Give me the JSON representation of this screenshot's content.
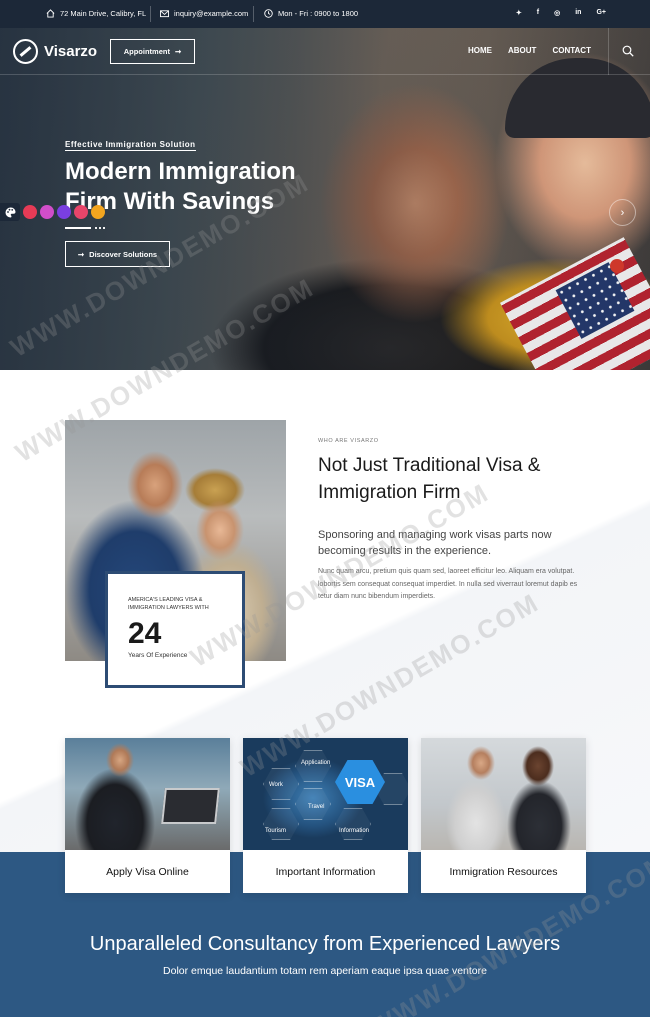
{
  "topbar": {
    "address": "72 Main Drive, Calibry, FL",
    "email": "inquiry@example.com",
    "hours": "Mon - Fri : 0900 to 1800",
    "socials": [
      "twitter",
      "facebook",
      "instagram",
      "linkedin",
      "google-plus"
    ],
    "social_glyphs": [
      "✦",
      "f",
      "◎",
      "in",
      "G+"
    ]
  },
  "nav": {
    "brand": "Visarzo",
    "appointment": "Appointment",
    "menu": [
      "HOME",
      "ABOUT",
      "CONTACT"
    ]
  },
  "hero": {
    "eyebrow": "Effective Immigration Solution",
    "title": "Modern Immigration Firm With Savings",
    "cta": "Discover Solutions",
    "swatch_colors": [
      "#e63b56",
      "#d04ec9",
      "#7a3fe0",
      "#e8456a",
      "#f3a51f"
    ]
  },
  "about": {
    "eyebrow": "WHO ARE VISARZO",
    "title": "Not Just Traditional Visa & Immigration Firm",
    "lead": "Sponsoring and managing work visas parts now becoming results in the experience.",
    "body": "Nunc quam arcu, pretium quis quam sed, laoreet efficitur leo. Aliquam era volutpat. lobortis sem consequat consequat imperdiet. In nulla sed viverraut loremut dapib es tetur diam nunc bibendum imperdiets.",
    "experience": {
      "caption": "AMERICA'S LEADING VISA & IMMIGRATION LAWYERS WITH",
      "number": "24",
      "label": "Years Of Experience"
    }
  },
  "services": {
    "cards": [
      {
        "label": "Apply Visa Online"
      },
      {
        "label": "Important Information",
        "image_words": [
          "Application",
          "Work",
          "Travel",
          "Tourism",
          "Information",
          "VISA"
        ]
      },
      {
        "label": "Immigration Resources"
      }
    ]
  },
  "band": {
    "title": "Unparalleled Consultancy from Experienced Lawyers",
    "subtitle": "Dolor emque laudantium totam rem aperiam eaque ipsa quae ventore"
  },
  "watermark": "WWW.DOWNDEMO.COM",
  "colors": {
    "topbar_bg": "#1c2838",
    "accent_blue": "#2d5883",
    "box_border": "#2d4c74"
  }
}
